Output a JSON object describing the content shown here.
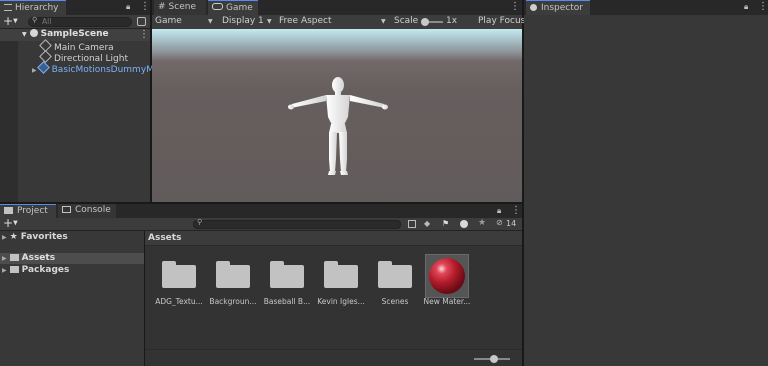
{
  "hierarchy": {
    "tab_label": "Hierarchy",
    "search_placeholder": "All",
    "items": [
      {
        "label": "SampleScene"
      },
      {
        "label": "Main Camera"
      },
      {
        "label": "Directional Light"
      },
      {
        "label": "BasicMotionsDummyMo"
      }
    ]
  },
  "scene_tabs": [
    {
      "label": "Scene"
    },
    {
      "label": "Game"
    }
  ],
  "game_toolbar": {
    "mode": "Game",
    "display": "Display 1",
    "aspect": "Free Aspect",
    "scale_label": "Scale",
    "scale_value": "1x",
    "play_focus": "Play Focus"
  },
  "inspector": {
    "tab_label": "Inspector"
  },
  "project": {
    "tabs": [
      {
        "label": "Project"
      },
      {
        "label": "Console"
      }
    ],
    "hidden_count": "14",
    "tree": [
      {
        "label": "Favorites"
      },
      {
        "label": "Assets"
      },
      {
        "label": "Packages"
      }
    ],
    "breadcrumb": "Assets",
    "assets": [
      {
        "label": "ADG_Textu..."
      },
      {
        "label": "Backgroun..."
      },
      {
        "label": "Baseball B..."
      },
      {
        "label": "Kevin Igles..."
      },
      {
        "label": "Scenes"
      },
      {
        "label": "New Mater..."
      }
    ]
  },
  "colors": {
    "accent": "#4f8ff0",
    "prefab_blue": "#7ab2f7",
    "sky_top": "#c5e8f0",
    "ground": "#675f5e",
    "material": "#c3202f"
  }
}
